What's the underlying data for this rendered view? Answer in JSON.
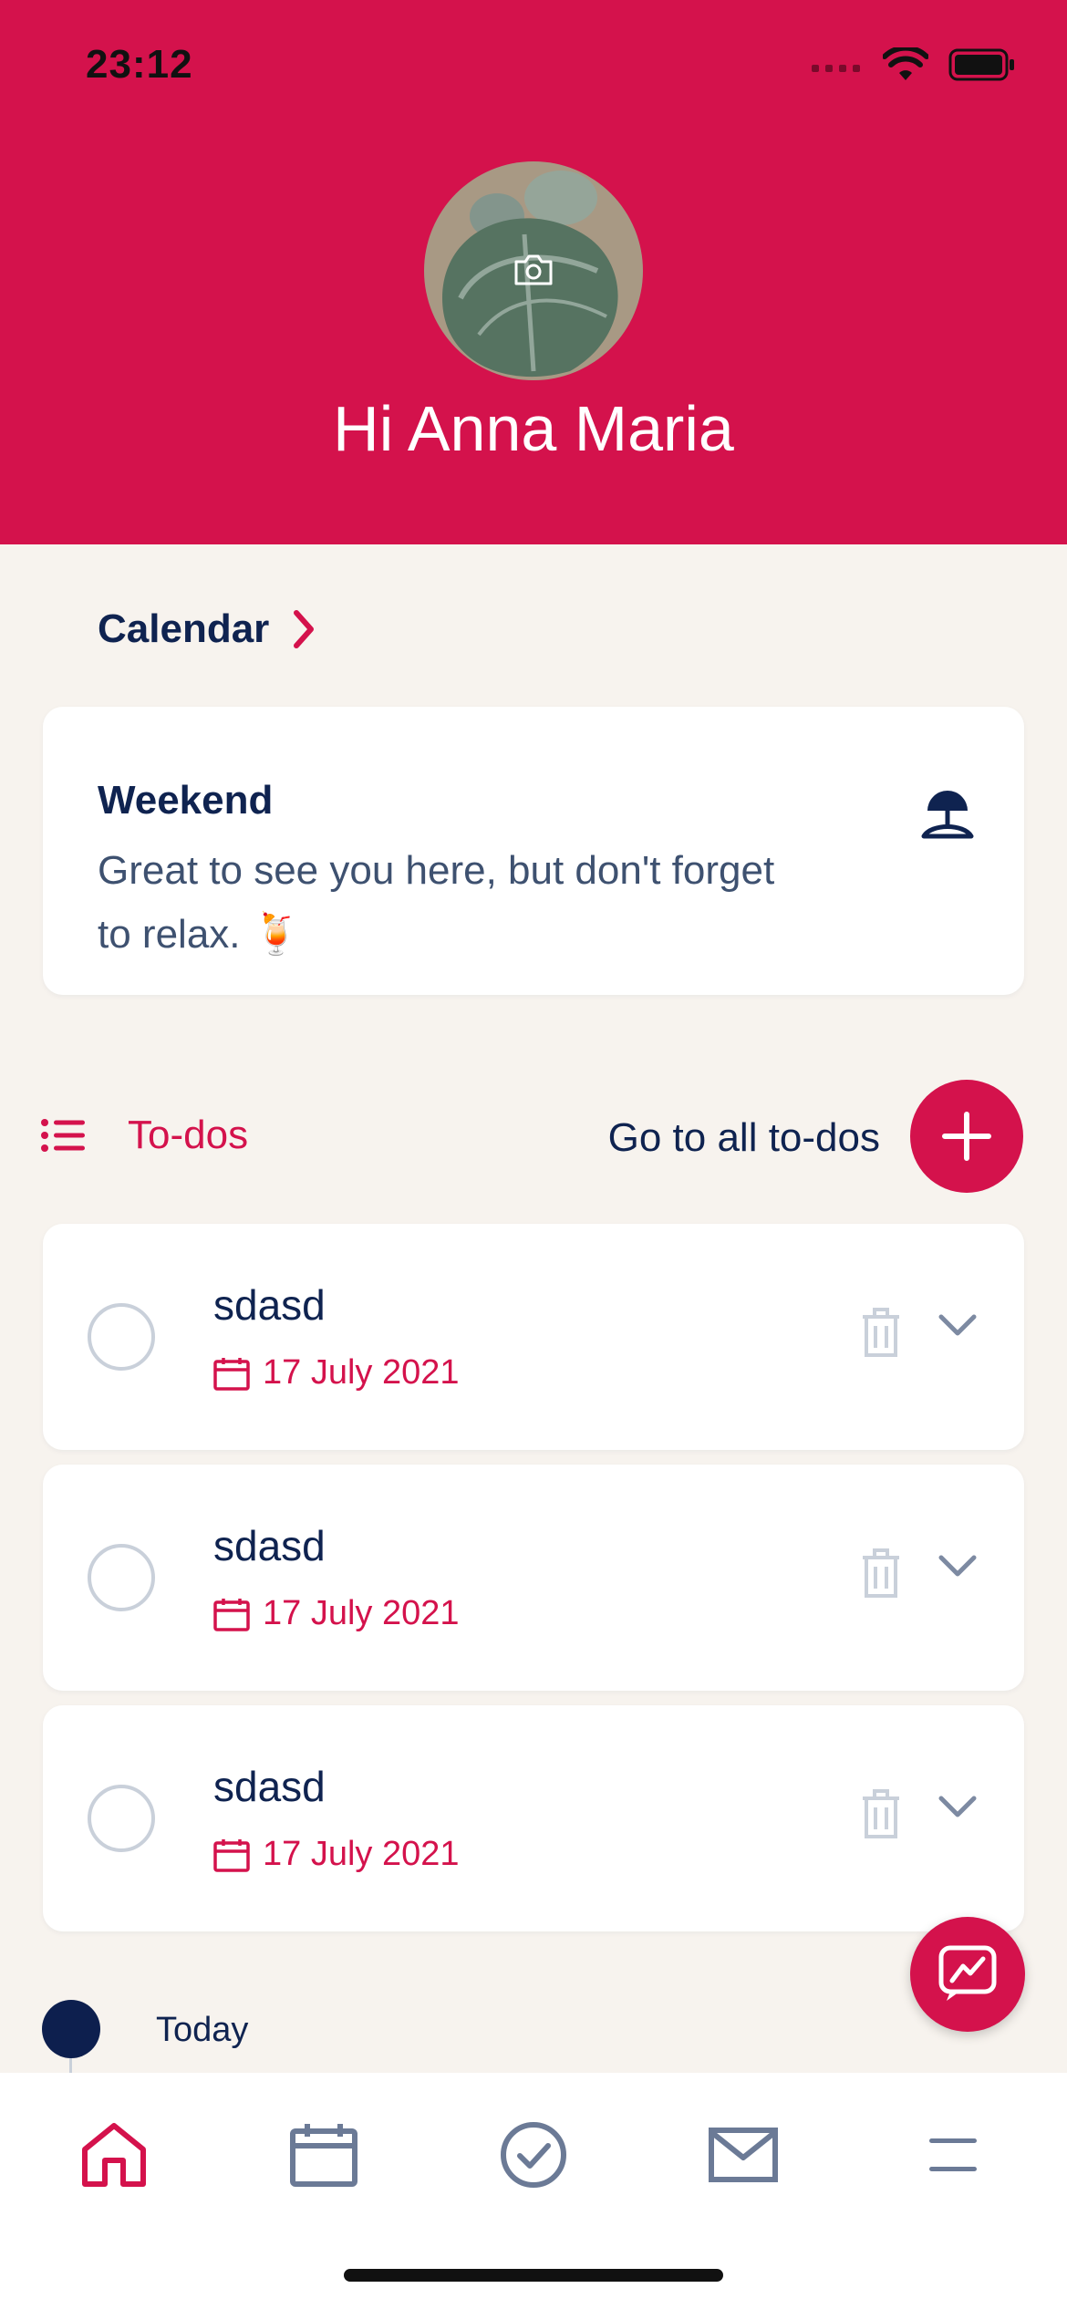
{
  "status_bar": {
    "time": "23:12"
  },
  "profile": {
    "greeting": "Hi Anna Maria"
  },
  "calendar": {
    "label": "Calendar"
  },
  "weekend_card": {
    "title": "Weekend",
    "message": "Great to see you here, but don't forget to relax. 🍹"
  },
  "todos": {
    "label": "To-dos",
    "go_all_label": "Go to all to-dos",
    "items": [
      {
        "title": "sdasd",
        "date": "17 July 2021"
      },
      {
        "title": "sdasd",
        "date": "17 July 2021"
      },
      {
        "title": "sdasd",
        "date": "17 July 2021"
      }
    ]
  },
  "timeline": {
    "today_label": "Today"
  },
  "tab_bar": {
    "items": [
      {
        "icon": "home-icon",
        "active": true
      },
      {
        "icon": "calendar-icon",
        "active": false
      },
      {
        "icon": "check-circle-icon",
        "active": false
      },
      {
        "icon": "mail-icon",
        "active": false
      },
      {
        "icon": "menu-icon",
        "active": false
      }
    ]
  },
  "colors": {
    "accent": "#d4124c",
    "navy": "#0f2350",
    "background": "#f7f3ee",
    "muted": "#c9d0da"
  }
}
